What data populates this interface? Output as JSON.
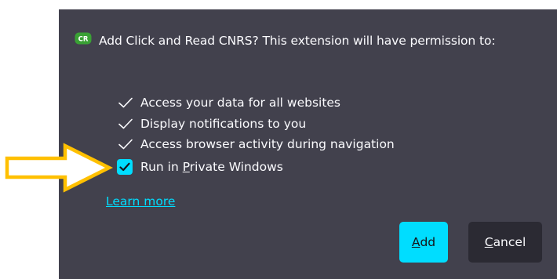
{
  "dialog": {
    "title": "Add Click and Read CNRS? This extension will have permission to:",
    "extension_icon_text": "CR",
    "permissions": [
      "Access your data for all websites",
      "Display notifications to you",
      "Access browser activity during navigation"
    ],
    "private_windows": {
      "label_before": "Run in ",
      "label_underlined": "P",
      "label_after": "rivate Windows",
      "checked": true
    },
    "learn_more": "Learn more",
    "add_button": {
      "underlined": "A",
      "rest": "dd"
    },
    "cancel_button": {
      "underlined": "C",
      "rest": "ancel"
    }
  },
  "colors": {
    "dialog_bg": "#42414d",
    "accent": "#00ddff",
    "cancel_bg": "#2b2a33",
    "arrow": "#ffc000",
    "text": "#fbfbfe"
  },
  "icons": {
    "extension": "click-and-read-icon",
    "permission": "checkmark-icon",
    "annotation": "arrow-right-icon"
  }
}
